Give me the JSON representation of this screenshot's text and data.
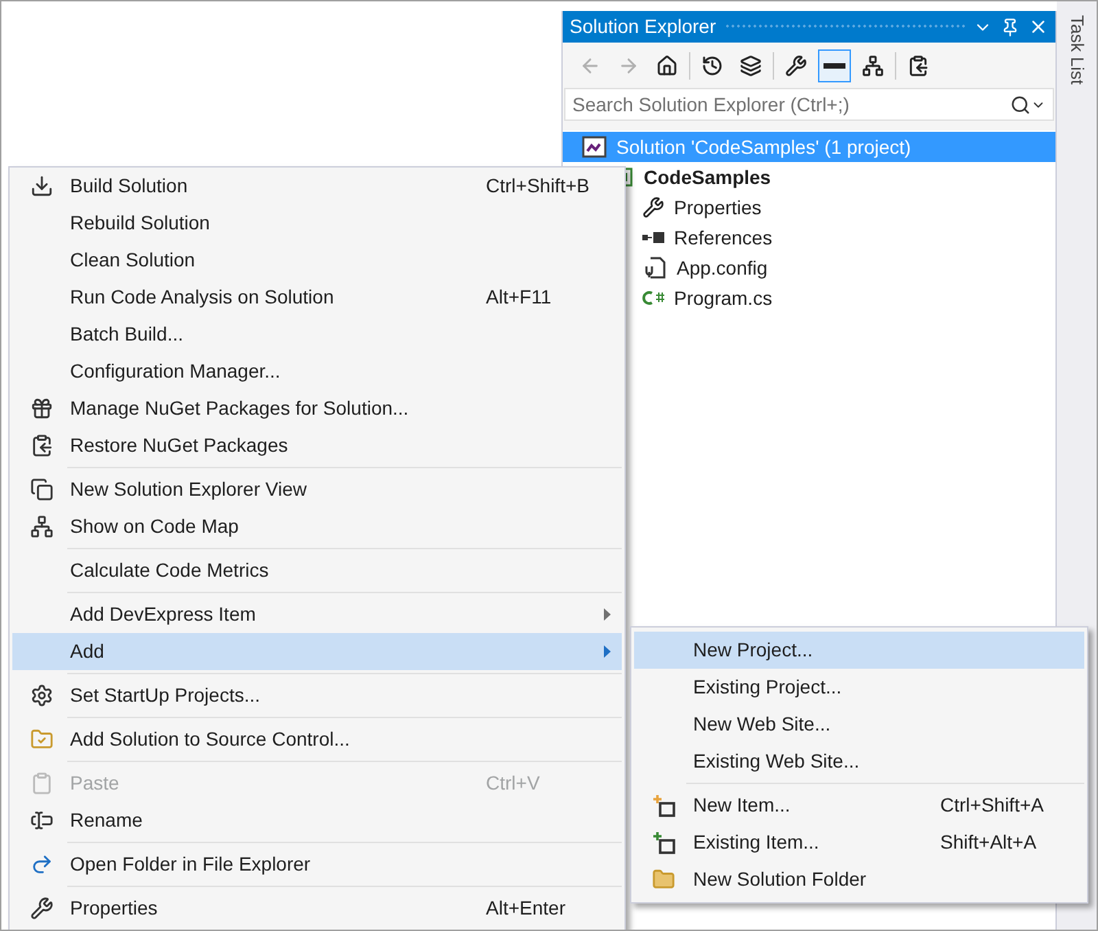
{
  "solution_explorer": {
    "title": "Solution Explorer",
    "toolbar": [
      {
        "disabled": true,
        "selected": false
      },
      {
        "disabled": true,
        "selected": false
      },
      {
        "disabled": false,
        "selected": false
      },
      {
        "disabled": false,
        "selected": false
      },
      {
        "disabled": false,
        "selected": false
      },
      {
        "disabled": false,
        "selected": false
      },
      {
        "disabled": false,
        "selected": true
      },
      {
        "disabled": false,
        "selected": false
      },
      {
        "disabled": false,
        "selected": false
      }
    ],
    "search": {
      "placeholder": "Search Solution Explorer (Ctrl+;)"
    },
    "tree": [
      {
        "label": "Solution 'CodeSamples' (1 project)",
        "kind": "solution",
        "selected": true,
        "children": [
          {
            "label": "CodeSamples",
            "kind": "project",
            "selected": false,
            "children": [
              {
                "label": "Properties",
                "kind": "properties",
                "selected": false
              },
              {
                "label": "References",
                "kind": "references",
                "selected": false
              },
              {
                "label": "App.config",
                "kind": "config",
                "selected": false
              },
              {
                "label": "Program.cs",
                "kind": "csharp",
                "selected": false
              }
            ]
          }
        ]
      }
    ]
  },
  "side_tab": {
    "label": "Task List"
  },
  "context_menu": {
    "groups": [
      [
        {
          "label": "Build Solution",
          "shortcut": "Ctrl+Shift+B",
          "disabled": false,
          "selected": false,
          "submenu": false
        },
        {
          "label": "Rebuild Solution",
          "disabled": false,
          "selected": false,
          "submenu": false
        },
        {
          "label": "Clean Solution",
          "disabled": false,
          "selected": false,
          "submenu": false
        },
        {
          "label": "Run Code Analysis on Solution",
          "shortcut": "Alt+F11",
          "disabled": false,
          "selected": false,
          "submenu": false
        },
        {
          "label": "Batch Build...",
          "disabled": false,
          "selected": false,
          "submenu": false
        },
        {
          "label": "Configuration Manager...",
          "disabled": false,
          "selected": false,
          "submenu": false
        },
        {
          "label": "Manage NuGet Packages for Solution...",
          "disabled": false,
          "selected": false,
          "submenu": false
        },
        {
          "label": "Restore NuGet Packages",
          "disabled": false,
          "selected": false,
          "submenu": false
        }
      ],
      [
        {
          "label": "New Solution Explorer View",
          "disabled": false,
          "selected": false,
          "submenu": false
        },
        {
          "label": "Show on Code Map",
          "disabled": false,
          "selected": false,
          "submenu": false
        }
      ],
      [
        {
          "label": "Calculate Code Metrics",
          "disabled": false,
          "selected": false,
          "submenu": false
        }
      ],
      [
        {
          "label": "Add DevExpress Item",
          "disabled": false,
          "selected": false,
          "submenu": true
        },
        {
          "label": "Add",
          "disabled": false,
          "selected": true,
          "submenu": true
        }
      ],
      [
        {
          "label": "Set StartUp Projects...",
          "disabled": false,
          "selected": false,
          "submenu": false
        }
      ],
      [
        {
          "label": "Add Solution to Source Control...",
          "disabled": false,
          "selected": false,
          "submenu": false
        }
      ],
      [
        {
          "label": "Paste",
          "shortcut": "Ctrl+V",
          "disabled": true,
          "selected": false,
          "submenu": false
        },
        {
          "label": "Rename",
          "disabled": false,
          "selected": false,
          "submenu": false
        }
      ],
      [
        {
          "label": "Open Folder in File Explorer",
          "disabled": false,
          "selected": false,
          "submenu": false
        }
      ],
      [
        {
          "label": "Properties",
          "shortcut": "Alt+Enter",
          "disabled": false,
          "selected": false,
          "submenu": false
        }
      ]
    ]
  },
  "submenu": {
    "groups": [
      [
        {
          "label": "New Project...",
          "selected": true
        },
        {
          "label": "Existing Project...",
          "selected": false
        },
        {
          "label": "New Web Site...",
          "selected": false
        },
        {
          "label": "Existing Web Site...",
          "selected": false
        }
      ],
      [
        {
          "label": "New Item...",
          "shortcut": "Ctrl+Shift+A",
          "selected": false
        },
        {
          "label": "Existing Item...",
          "shortcut": "Shift+Alt+A",
          "selected": false
        },
        {
          "label": "New Solution Folder",
          "selected": false
        }
      ]
    ]
  }
}
